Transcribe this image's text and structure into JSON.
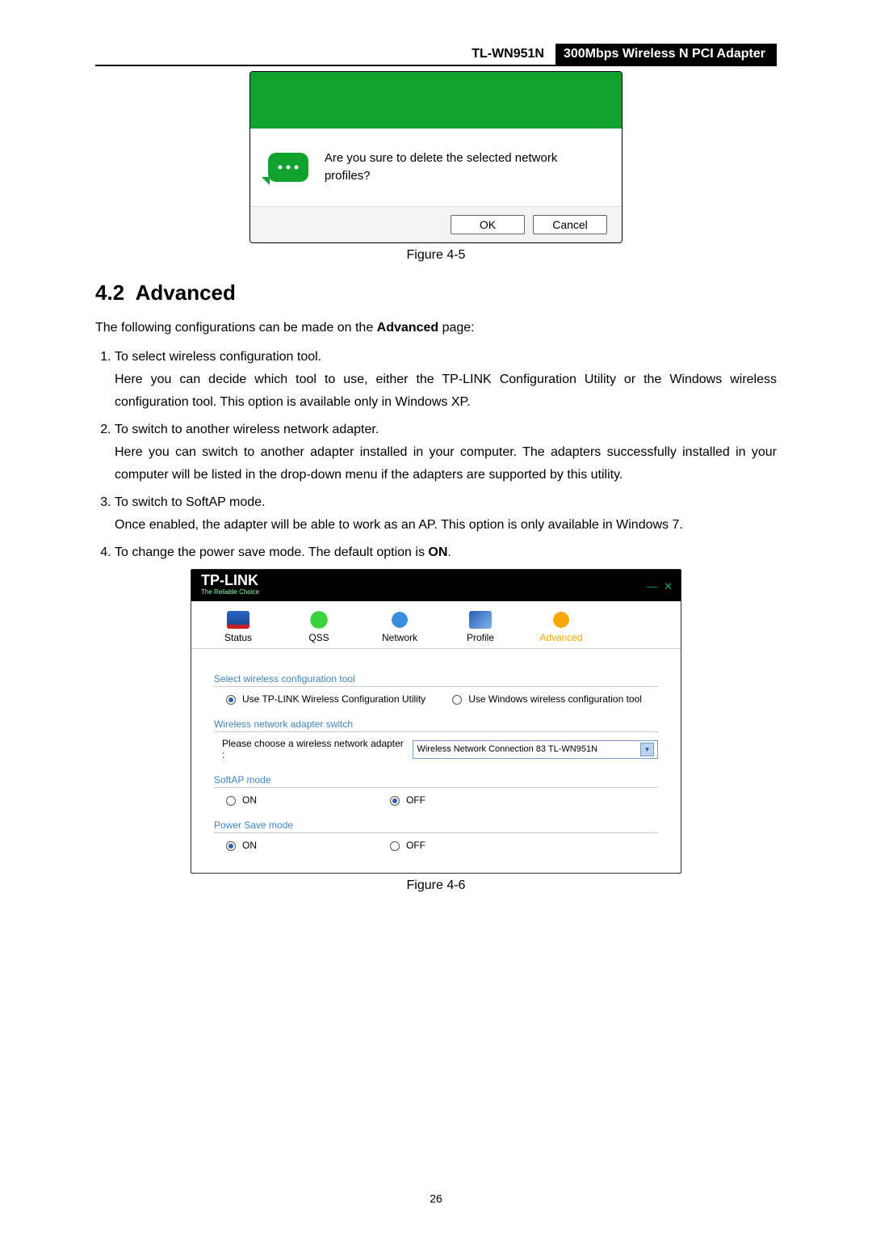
{
  "header": {
    "model": "TL-WN951N",
    "desc": "300Mbps Wireless N PCI Adapter"
  },
  "fig45": {
    "caption": "Figure 4-5",
    "msg": "Are you sure to delete the selected network profiles?",
    "ok": "OK",
    "cancel": "Cancel"
  },
  "section": {
    "num": "4.2",
    "title": "Advanced",
    "intro_a": "The following configurations can be made on the ",
    "intro_b": "Advanced",
    "intro_c": " page:",
    "items": [
      {
        "lead": "To select wireless configuration tool.",
        "body": "Here you can decide which tool to use, either the TP-LINK Configuration Utility or the Windows wireless configuration tool. This option is available only in Windows XP."
      },
      {
        "lead": "To switch to another wireless network adapter.",
        "body": "Here you can switch to another adapter installed in your computer. The adapters successfully installed in your computer will be listed in the drop-down menu if the adapters are supported by this utility."
      },
      {
        "lead": "To switch to SoftAP mode.",
        "body": "Once enabled, the adapter will be able to work as an AP. This option is only available in Windows 7."
      },
      {
        "lead_a": "To change the power save mode. The default option is ",
        "lead_b": "ON",
        "lead_c": "."
      }
    ]
  },
  "fig46": {
    "caption": "Figure 4-6",
    "logo": "TP-LINK",
    "tagline": "The Reliable Choice",
    "tabs": {
      "status": "Status",
      "qss": "QSS",
      "network": "Network",
      "profile": "Profile",
      "advanced": "Advanced"
    },
    "group1": {
      "legend": "Select wireless configuration tool",
      "opt1": "Use TP-LINK Wireless Configuration Utility",
      "opt2": "Use Windows wireless configuration tool"
    },
    "group2": {
      "legend": "Wireless network adapter switch",
      "prompt": "Please choose a wireless network adapter :",
      "value": "Wireless Network Connection 83  TL-WN951N"
    },
    "group3": {
      "legend": "SoftAP mode",
      "on": "ON",
      "off": "OFF"
    },
    "group4": {
      "legend": "Power Save mode",
      "on": "ON",
      "off": "OFF"
    }
  },
  "page_number": "26"
}
